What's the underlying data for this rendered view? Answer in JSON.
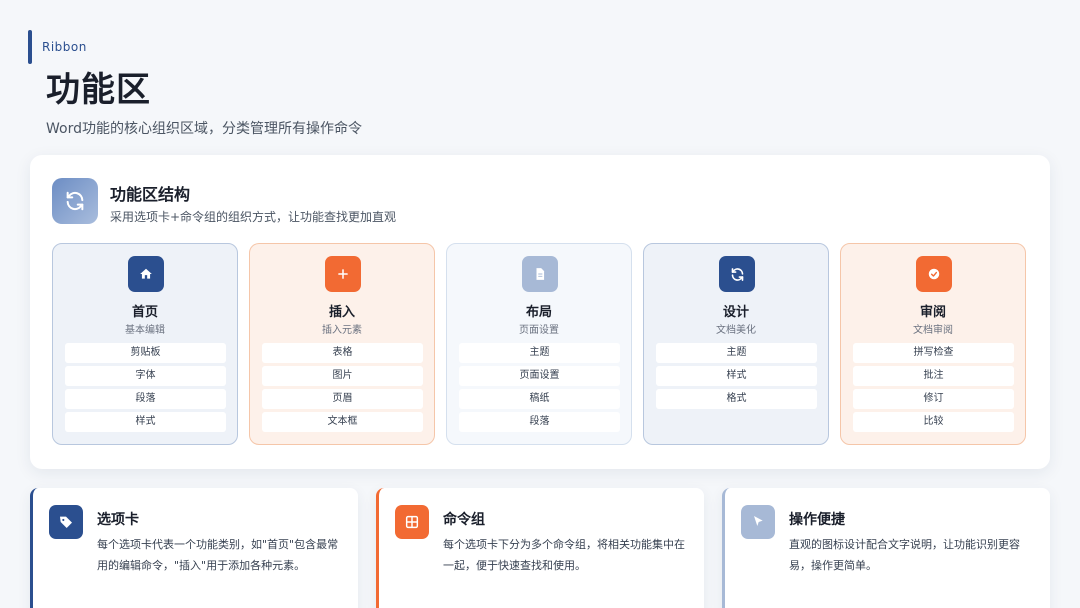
{
  "header": {
    "eyebrow": "Ribbon",
    "title": "功能区",
    "subtitle": "Word功能的核心组织区域，分类管理所有操作命令"
  },
  "structure": {
    "icon": "refresh-icon",
    "title": "功能区结构",
    "description": "采用选项卡+命令组的组织方式，让功能查找更加直观",
    "tabs": [
      {
        "icon": "home-icon",
        "name": "首页",
        "subtitle": "基本编辑",
        "commands": [
          "剪贴板",
          "字体",
          "段落",
          "样式"
        ]
      },
      {
        "icon": "plus-icon",
        "name": "插入",
        "subtitle": "插入元素",
        "commands": [
          "表格",
          "图片",
          "页眉",
          "文本框"
        ]
      },
      {
        "icon": "document-icon",
        "name": "布局",
        "subtitle": "页面设置",
        "commands": [
          "主题",
          "页面设置",
          "稿纸",
          "段落"
        ]
      },
      {
        "icon": "refresh-icon",
        "name": "设计",
        "subtitle": "文档美化",
        "commands": [
          "主题",
          "样式",
          "格式"
        ]
      },
      {
        "icon": "check-circle-icon",
        "name": "审阅",
        "subtitle": "文档审阅",
        "commands": [
          "拼写检查",
          "批注",
          "修订",
          "比较"
        ]
      }
    ]
  },
  "features": [
    {
      "icon": "tag-icon",
      "title": "选项卡",
      "description": "每个选项卡代表一个功能类别，如\"首页\"包含最常用的编辑命令，\"插入\"用于添加各种元素。"
    },
    {
      "icon": "grid-icon",
      "title": "命令组",
      "description": "每个选项卡下分为多个命令组，将相关功能集中在一起，便于快速查找和使用。"
    },
    {
      "icon": "cursor-icon",
      "title": "操作便捷",
      "description": "直观的图标设计配合文字说明，让功能识别更容易，操作更简单。"
    }
  ],
  "colors": {
    "navy": "#2b4f8f",
    "orange": "#f26a33",
    "pale_blue": "#a7b9d6"
  }
}
